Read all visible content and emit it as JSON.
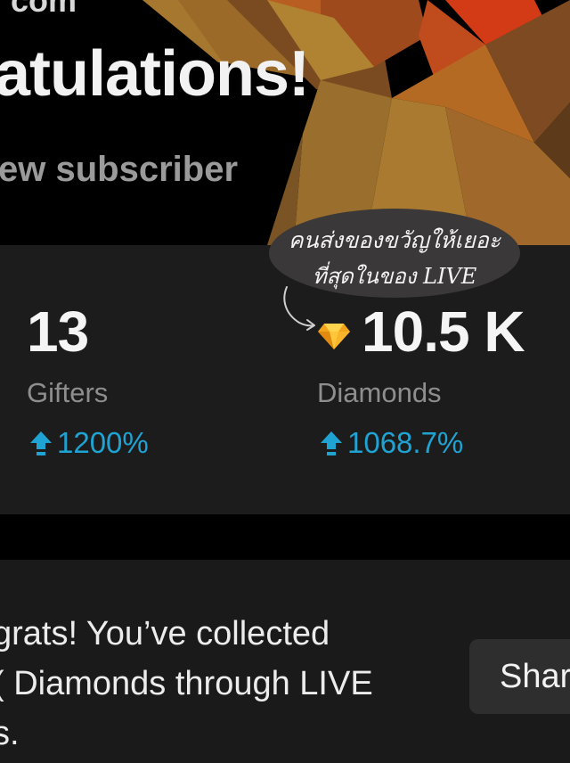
{
  "hero": {
    "cut_text": "com",
    "title": "atulations!",
    "subtitle": "ew subscriber"
  },
  "stats": {
    "gifters": {
      "value": "13",
      "label": "Gifters",
      "change": "1200%"
    },
    "diamonds": {
      "value": "10.5 K",
      "label": "Diamonds",
      "change": "1068.7%"
    }
  },
  "annotation": {
    "line1": "คนส่งของขวัญให้เยอะ",
    "line2": "ที่สุดในของ LIVE"
  },
  "message": {
    "line1": "grats! You’ve collected",
    "line2": "( Diamonds through LIVE",
    "line3": "s."
  },
  "share_button": {
    "label": "Shar"
  },
  "colors": {
    "background": "#000000",
    "card": "#1c1c1c",
    "accent": "#1fa3d3",
    "label": "#8e8e8e"
  },
  "icons": {
    "diamond": "diamond-icon",
    "increase": "arrow-up-icon"
  }
}
